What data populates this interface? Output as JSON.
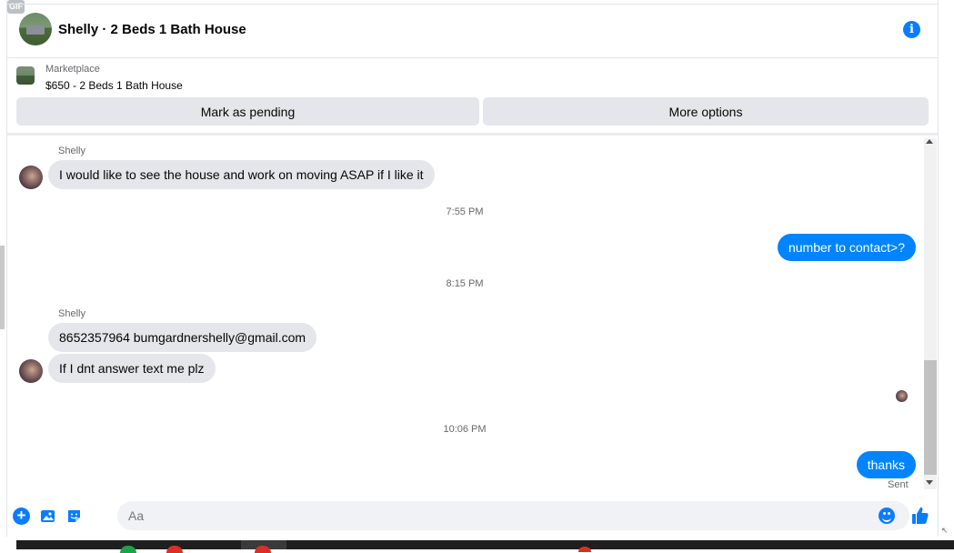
{
  "header": {
    "title": "Shelly · 2 Beds 1 Bath House",
    "info_icon": "info-icon"
  },
  "listing": {
    "label": "Marketplace",
    "price_title": "$650 - 2 Beds 1 Bath House"
  },
  "actions": {
    "pending_label": "Mark as pending",
    "more_label": "More options"
  },
  "messages": [
    {
      "sender": "Shelly",
      "text": "I would like to see the house and work on moving ASAP if I like it"
    },
    {
      "time": "7:55 PM"
    },
    {
      "outgoing": true,
      "text": "number to contact>?"
    },
    {
      "time": "8:15 PM"
    },
    {
      "sender": "Shelly",
      "text": "8652357964 bumgardnershelly@gmail.com"
    },
    {
      "text": "If I dnt answer text me plz"
    },
    {
      "time": "10:06 PM"
    },
    {
      "outgoing": true,
      "text": "thanks",
      "status": "Sent"
    }
  ],
  "composer": {
    "placeholder": "Aa",
    "gif_label": "GIF",
    "icons": [
      "plus-icon",
      "photo-icon",
      "sticker-icon",
      "gif-icon",
      "emoji-icon",
      "thumbs-up-icon"
    ]
  },
  "colors": {
    "accent": "#0084ff",
    "incoming_bubble": "#e4e6eb",
    "button_bg": "#e4e6eb"
  }
}
